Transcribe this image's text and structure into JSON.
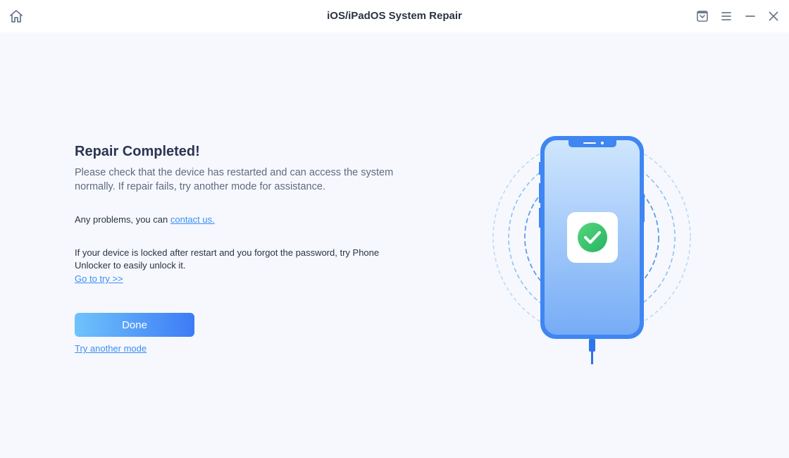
{
  "window": {
    "title": "iOS/iPadOS System Repair",
    "icons": [
      "home-icon",
      "feedback-icon",
      "menu-icon",
      "minimize-icon",
      "close-icon"
    ]
  },
  "result": {
    "heading": "Repair Completed!",
    "description": "Please check that the device has restarted and can access the system normally. If repair fails, try another mode for assistance.",
    "problems_text": "Any problems, you can ",
    "contact_link": "contact us.",
    "locked_text": "If your device is locked after restart and you forgot the password, try Phone Unlocker to easily unlock it.",
    "goto_link": "Go to try >>",
    "done_button": "Done",
    "another_mode_link": "Try another mode"
  },
  "colors": {
    "accent": "#3a8ef6",
    "success": "#3cc66c",
    "background": "#f6f8fd"
  }
}
